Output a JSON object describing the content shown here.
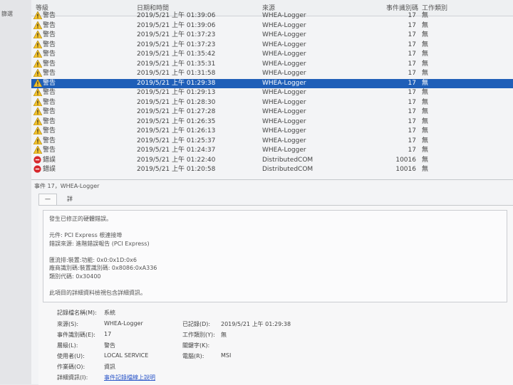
{
  "sidebar": {
    "label": "篩選"
  },
  "columns": {
    "level": "等級",
    "date": "日期和時間",
    "source": "來源",
    "event_id": "事件識別碼",
    "task": "工作類別"
  },
  "events": [
    {
      "level": "警告",
      "type": "warning",
      "date": "2019/5/21 上午 01:39:06",
      "source": "WHEA-Logger",
      "id": "17",
      "task": "無"
    },
    {
      "level": "警告",
      "type": "warning",
      "date": "2019/5/21 上午 01:39:06",
      "source": "WHEA-Logger",
      "id": "17",
      "task": "無"
    },
    {
      "level": "警告",
      "type": "warning",
      "date": "2019/5/21 上午 01:37:23",
      "source": "WHEA-Logger",
      "id": "17",
      "task": "無"
    },
    {
      "level": "警告",
      "type": "warning",
      "date": "2019/5/21 上午 01:37:23",
      "source": "WHEA-Logger",
      "id": "17",
      "task": "無"
    },
    {
      "level": "警告",
      "type": "warning",
      "date": "2019/5/21 上午 01:35:42",
      "source": "WHEA-Logger",
      "id": "17",
      "task": "無"
    },
    {
      "level": "警告",
      "type": "warning",
      "date": "2019/5/21 上午 01:35:31",
      "source": "WHEA-Logger",
      "id": "17",
      "task": "無"
    },
    {
      "level": "警告",
      "type": "warning",
      "date": "2019/5/21 上午 01:31:58",
      "source": "WHEA-Logger",
      "id": "17",
      "task": "無"
    },
    {
      "level": "警告",
      "type": "warning",
      "date": "2019/5/21 上午 01:29:38",
      "source": "WHEA-Logger",
      "id": "17",
      "task": "無",
      "selected": true
    },
    {
      "level": "警告",
      "type": "warning",
      "date": "2019/5/21 上午 01:29:13",
      "source": "WHEA-Logger",
      "id": "17",
      "task": "無"
    },
    {
      "level": "警告",
      "type": "warning",
      "date": "2019/5/21 上午 01:28:30",
      "source": "WHEA-Logger",
      "id": "17",
      "task": "無"
    },
    {
      "level": "警告",
      "type": "warning",
      "date": "2019/5/21 上午 01:27:28",
      "source": "WHEA-Logger",
      "id": "17",
      "task": "無"
    },
    {
      "level": "警告",
      "type": "warning",
      "date": "2019/5/21 上午 01:26:35",
      "source": "WHEA-Logger",
      "id": "17",
      "task": "無"
    },
    {
      "level": "警告",
      "type": "warning",
      "date": "2019/5/21 上午 01:26:13",
      "source": "WHEA-Logger",
      "id": "17",
      "task": "無"
    },
    {
      "level": "警告",
      "type": "warning",
      "date": "2019/5/21 上午 01:25:37",
      "source": "WHEA-Logger",
      "id": "17",
      "task": "無"
    },
    {
      "level": "警告",
      "type": "warning",
      "date": "2019/5/21 上午 01:24:37",
      "source": "WHEA-Logger",
      "id": "17",
      "task": "無"
    },
    {
      "level": "錯誤",
      "type": "error",
      "date": "2019/5/21 上午 01:22:40",
      "source": "DistributedCOM",
      "id": "10016",
      "task": "無"
    },
    {
      "level": "錯誤",
      "type": "error",
      "date": "2019/5/21 上午 01:20:58",
      "source": "DistributedCOM",
      "id": "10016",
      "task": "無"
    }
  ],
  "detail": {
    "header": "事件 17，WHEA-Logger",
    "tabs": [
      "一般",
      "詳細資料"
    ],
    "description": [
      "發生已修正的硬體錯誤。",
      "",
      "元件: PCI Express 根連接埠",
      "錯誤來源: 進階錯誤報告 (PCI Express)",
      "",
      "匯流排:裝置:功能: 0x0:0x1D:0x6",
      "廠商識別碼:裝置識別碼: 0x8086:0xA336",
      "類別代碼: 0x30400",
      "",
      "此項目的詳細資料檢視包含詳細資訊。"
    ],
    "props": {
      "log_name_label": "記錄檔名稱(M):",
      "log_name": "系統",
      "source_label": "來源(S):",
      "source": "WHEA-Logger",
      "logged_label": "已記錄(D):",
      "logged": "2019/5/21 上午 01:29:38",
      "event_id_label": "事件識別碼(E):",
      "event_id": "17",
      "task_label": "工作類別(Y):",
      "task": "無",
      "level_label": "層級(L):",
      "level": "警告",
      "keywords_label": "關鍵字(K):",
      "keywords": "",
      "user_label": "使用者(U):",
      "user": "LOCAL SERVICE",
      "computer_label": "電腦(R):",
      "computer": "MSI",
      "opcode_label": "作業碼(O):",
      "opcode": "資訊",
      "more_info_label": "詳細資訊(I):",
      "more_info_link": "事件記錄檔線上說明"
    }
  }
}
